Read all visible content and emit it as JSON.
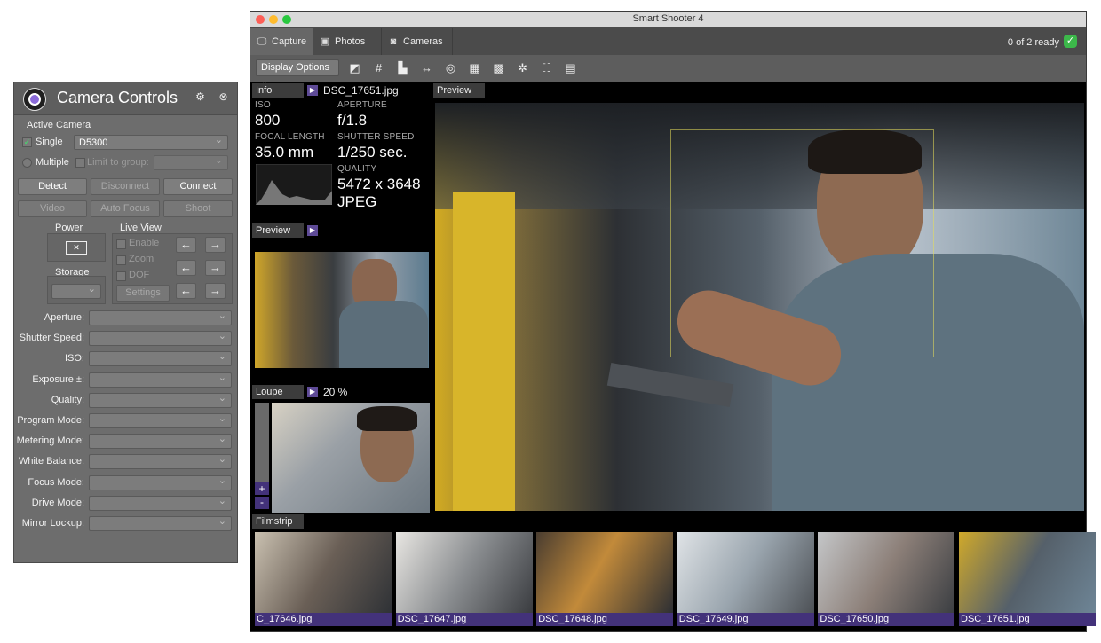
{
  "camera_controls": {
    "title": "Camera Controls",
    "header_icons": [
      "gear-icon",
      "close-icon"
    ],
    "active_camera_label": "Active Camera",
    "single_label": "Single",
    "single_checked": true,
    "camera_value": "D5300",
    "multiple_label": "Multiple",
    "limit_label": "Limit to group:",
    "buttons": {
      "detect": "Detect",
      "disconnect": "Disconnect",
      "connect": "Connect",
      "video": "Video",
      "auto_focus": "Auto Focus",
      "shoot": "Shoot"
    },
    "power_label": "Power",
    "storage_label": "Storage",
    "live_view_label": "Live View",
    "live_view_options": {
      "enable": "Enable",
      "zoom": "Zoom",
      "dof": "DOF"
    },
    "settings_label": "Settings",
    "properties": {
      "aperture": "Aperture:",
      "shutter_speed": "Shutter Speed:",
      "iso": "ISO:",
      "exposure": "Exposure ±:",
      "quality": "Quality:",
      "program_mode": "Program Mode:",
      "metering_mode": "Metering Mode:",
      "white_balance": "White Balance:",
      "focus_mode": "Focus Mode:",
      "drive_mode": "Drive Mode:",
      "mirror_lockup": "Mirror Lockup:"
    }
  },
  "window": {
    "title": "Smart Shooter 4",
    "tabs": {
      "capture": "Capture",
      "photos": "Photos",
      "cameras": "Cameras"
    },
    "active_tab": "Capture",
    "status": "0 of 2 ready",
    "toolbar": {
      "display_options": "Display Options",
      "tool_icons": [
        "exposure-icon",
        "grid-icon",
        "histogram-icon",
        "measure-icon",
        "capture-icon",
        "overlay-icon",
        "checker-icon",
        "focus-icon",
        "crop-icon",
        "qr-code-icon"
      ]
    },
    "info": {
      "title": "Info",
      "filename": "DSC_17651.jpg",
      "iso_label": "ISO",
      "iso": "800",
      "aperture_label": "APERTURE",
      "aperture": "f/1.8",
      "focal_length_label": "FOCAL LENGTH",
      "focal_length": "35.0 mm",
      "shutter_speed_label": "SHUTTER SPEED",
      "shutter_speed": "1/250 sec.",
      "quality_label": "QUALITY",
      "resolution": "5472 x 3648",
      "format": "JPEG"
    },
    "preview_small_title": "Preview",
    "loupe": {
      "title": "Loupe",
      "zoom": "20 %",
      "plus": "+",
      "minus": "-"
    },
    "preview_title": "Preview",
    "filmstrip": {
      "title": "Filmstrip",
      "items": [
        "C_17646.jpg",
        "DSC_17647.jpg",
        "DSC_17648.jpg",
        "DSC_17649.jpg",
        "DSC_17650.jpg",
        "DSC_17651.jpg"
      ]
    }
  },
  "colors": {
    "accent": "#5e4a96",
    "ready_green": "#3cb84a",
    "panel_gray": "#6d6d6d"
  }
}
